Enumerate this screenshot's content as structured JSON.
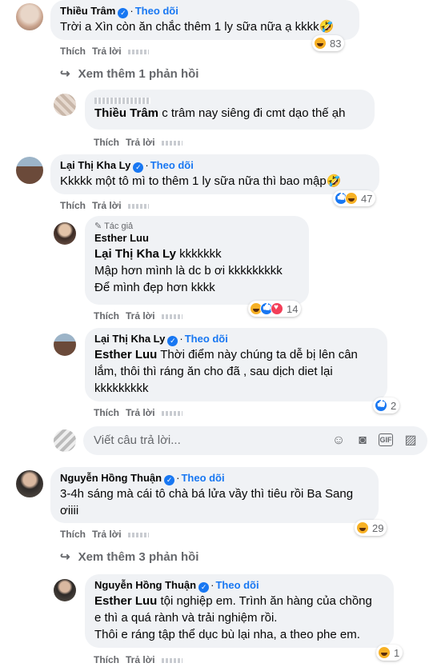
{
  "follow_label": "Theo dõi",
  "like_action": "Thích",
  "reply_action": "Trả lời",
  "author_badge": "Tác giả",
  "comments": [
    {
      "name": "Thiều Trâm",
      "text": "Trời a Xìn còn ăn chắc thêm 1 ly sữa nữa ạ kkkk🤣",
      "reaction_count": "83"
    },
    {
      "name": "Lại Thị Kha Ly",
      "text": "Kkkkk một tô mì to thêm 1 ly sữa nữa thì bao mập🤣",
      "reaction_count": "47"
    },
    {
      "name": "Nguyễn Hồng Thuận",
      "text": "3-4h sáng mà cái tô chà bá lửa vầy thì tiêu rồi Ba Sang ơiiii",
      "reaction_count": "29"
    }
  ],
  "more_replies_1": "Xem thêm 1 phản hồi",
  "more_replies_2": "Xem thêm 3 phản hồi",
  "reply_a": {
    "mention": "Thiều Trâm",
    "text": "c trâm nay siêng đi cmt dạo thế ạh"
  },
  "reply_b": {
    "name": "Esther Luu",
    "mention": "Lại Thị Kha Ly",
    "text1": " kkkkkkk",
    "text2": "Mập hơn mình là dc b ơi kkkkkkkkk",
    "text3": "Để mình đẹp hơn kkkk",
    "reaction_count": "14"
  },
  "reply_c": {
    "name": "Lại Thị Kha Ly",
    "mention": "Esther Luu",
    "text1": " Thời điểm này chúng ta dễ bị lên cân",
    "text2": "lắm, thôi thì ráng ăn cho đã , sau dịch diet lại",
    "text3": "kkkkkkkkk",
    "reaction_count": "2"
  },
  "reply_d": {
    "name": "Nguyễn Hồng Thuận",
    "mention": "Esther Luu",
    "text1": " tội nghiệp em. Trình ăn hàng của chồng",
    "text2": "e thì a quá rành và trải nghiệm rồi.",
    "text3": "Thôi e ráng tập thể dục bù lại nha, a theo phe em.",
    "reaction_count": "1"
  },
  "reply_input": {
    "placeholder": "Viết câu trả lời..."
  },
  "icons": [
    "verified-icon",
    "reply-arrow-icon",
    "emoji-icon",
    "camera-icon",
    "gif-icon",
    "sticker-icon",
    "haha-reaction-icon",
    "like-reaction-icon",
    "love-reaction-icon",
    "pencil-icon"
  ],
  "colors": {
    "accent": "#1877f2",
    "bubble": "#f0f2f5",
    "muted": "#65676b"
  }
}
